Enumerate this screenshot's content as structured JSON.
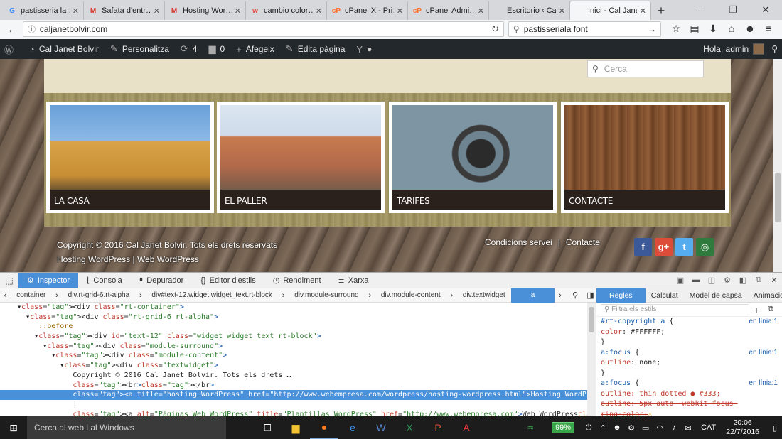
{
  "browser": {
    "tabs": [
      {
        "label": "pastisseria la …",
        "icon": "google-icon",
        "icon_text": "G",
        "icon_color": "#4285f4"
      },
      {
        "label": "Safata d'entr…",
        "icon": "gmail-icon",
        "icon_text": "M",
        "icon_color": "#d93025"
      },
      {
        "label": "Hosting Wor…",
        "icon": "gmail-icon",
        "icon_text": "M",
        "icon_color": "#d93025"
      },
      {
        "label": "cambio color…",
        "icon": "webempresa-icon",
        "icon_text": "w",
        "icon_color": "#e2483d"
      },
      {
        "label": "cPanel X - Pri…",
        "icon": "cpanel-icon",
        "icon_text": "cP",
        "icon_color": "#ff6c2c"
      },
      {
        "label": "cPanel Admi…",
        "icon": "cpanel-icon",
        "icon_text": "cP",
        "icon_color": "#ff6c2c"
      },
      {
        "label": "Escritorio ‹ Cal Ja…",
        "icon": "",
        "icon_text": "",
        "icon_color": "#888"
      },
      {
        "label": "Inici - Cal Janet B…",
        "icon": "",
        "icon_text": "",
        "icon_color": "#888",
        "active": true
      }
    ],
    "new_tab_label": "+",
    "url": "caljanetbolvir.com",
    "search_value": "pastisseriala font"
  },
  "adminbar": {
    "site_name": "Cal Janet Bolvir",
    "customize": "Personalitza",
    "updates_count": "4",
    "comments_count": "0",
    "add_new": "Afegeix",
    "edit_page": "Edita pàgina",
    "greeting": "Hola, admin"
  },
  "site": {
    "search_placeholder": "Cerca",
    "cards": [
      {
        "label": "LA CASA"
      },
      {
        "label": "EL PALLER"
      },
      {
        "label": "TARIFES"
      },
      {
        "label": "CONTACTE"
      }
    ],
    "copyright": "Copyright © 2016 Cal Janet Bolvir. Tots els drets reservats",
    "hosting_link": "Hosting WordPress",
    "web_link": "Web WordPress",
    "footer_links": [
      "Condicions servei",
      "Contacte"
    ],
    "social": [
      {
        "name": "facebook",
        "glyph": "f",
        "color": "#3b5998"
      },
      {
        "name": "google-plus",
        "glyph": "g+",
        "color": "#dd4b39"
      },
      {
        "name": "twitter",
        "glyph": "t",
        "color": "#55acee"
      },
      {
        "name": "tripadvisor",
        "glyph": "◎",
        "color": "#2f7a3d"
      }
    ]
  },
  "devtools": {
    "tabs": [
      "Inspector",
      "Consola",
      "Depurador",
      "Editor d'estils",
      "Rendiment",
      "Xarxa"
    ],
    "breadcrumbs": [
      "container",
      "div.rt-grid-6.rt-alpha",
      "div#text-12.widget.widget_text.rt-block",
      "div.module-surround",
      "div.module-content",
      "div.textwidget",
      "a"
    ],
    "markup_lines": [
      {
        "indent": 4,
        "html": "<div class=\"rt-container\">"
      },
      {
        "indent": 6,
        "html": "<div class=\"rt-grid-6 rt-alpha\">"
      },
      {
        "indent": 8,
        "html": "::before"
      },
      {
        "indent": 8,
        "html": "<div id=\"text-12\" class=\"widget widget_text rt-block\">"
      },
      {
        "indent": 10,
        "html": "<div class=\"module-surround\">"
      },
      {
        "indent": 12,
        "html": "<div class=\"module-content\">"
      },
      {
        "indent": 14,
        "html": "<div class=\"textwidget\">"
      },
      {
        "indent": 16,
        "html": "Copyright © 2016 Cal Janet Bolvir. Tots els drets …"
      },
      {
        "indent": 16,
        "html": "<br></br>"
      },
      {
        "indent": 16,
        "html": "<a title=\"hosting WordPress\" href=\"http://www.webempresa.com/wordpress/hosting-wordpress.html\">Hosting WordPress</a>",
        "selected": true
      },
      {
        "indent": 16,
        "html": "|"
      },
      {
        "indent": 16,
        "html": "<a alt=\"Páginas Web WordPress\" title=\"Plantillas WordPress\" href=\"http://www.webempresa.com\">Web WordPress</a>"
      }
    ],
    "side_tabs": [
      "Regles",
      "Calculat",
      "Model de capsa",
      "Animacions"
    ],
    "filter_placeholder": "Filtra els estils",
    "rules": [
      {
        "type": "sel",
        "text": "#rt-copyright a",
        "src": "en línia:1"
      },
      {
        "type": "prop",
        "name": "color",
        "value": "#FFFFFF;"
      },
      {
        "type": "close",
        "text": "}"
      },
      {
        "type": "sel",
        "text": "a:focus",
        "src": "en línia:1"
      },
      {
        "type": "prop",
        "name": "outline",
        "value": "none;"
      },
      {
        "type": "close",
        "text": "}"
      },
      {
        "type": "sel",
        "text": "a:focus",
        "src": "en línia:1"
      },
      {
        "type": "strike",
        "name": "outline",
        "value": "thin dotted ● #333;"
      },
      {
        "type": "strike",
        "name": "outline",
        "value": "5px auto -webkit-focus-"
      },
      {
        "type": "strike-cont",
        "value": "ring-color;"
      }
    ]
  },
  "taskbar": {
    "search_placeholder": "Cerca al web i al Windows",
    "battery": "99%",
    "language": "CAT",
    "time": "20:06",
    "date": "22/7/2016"
  }
}
